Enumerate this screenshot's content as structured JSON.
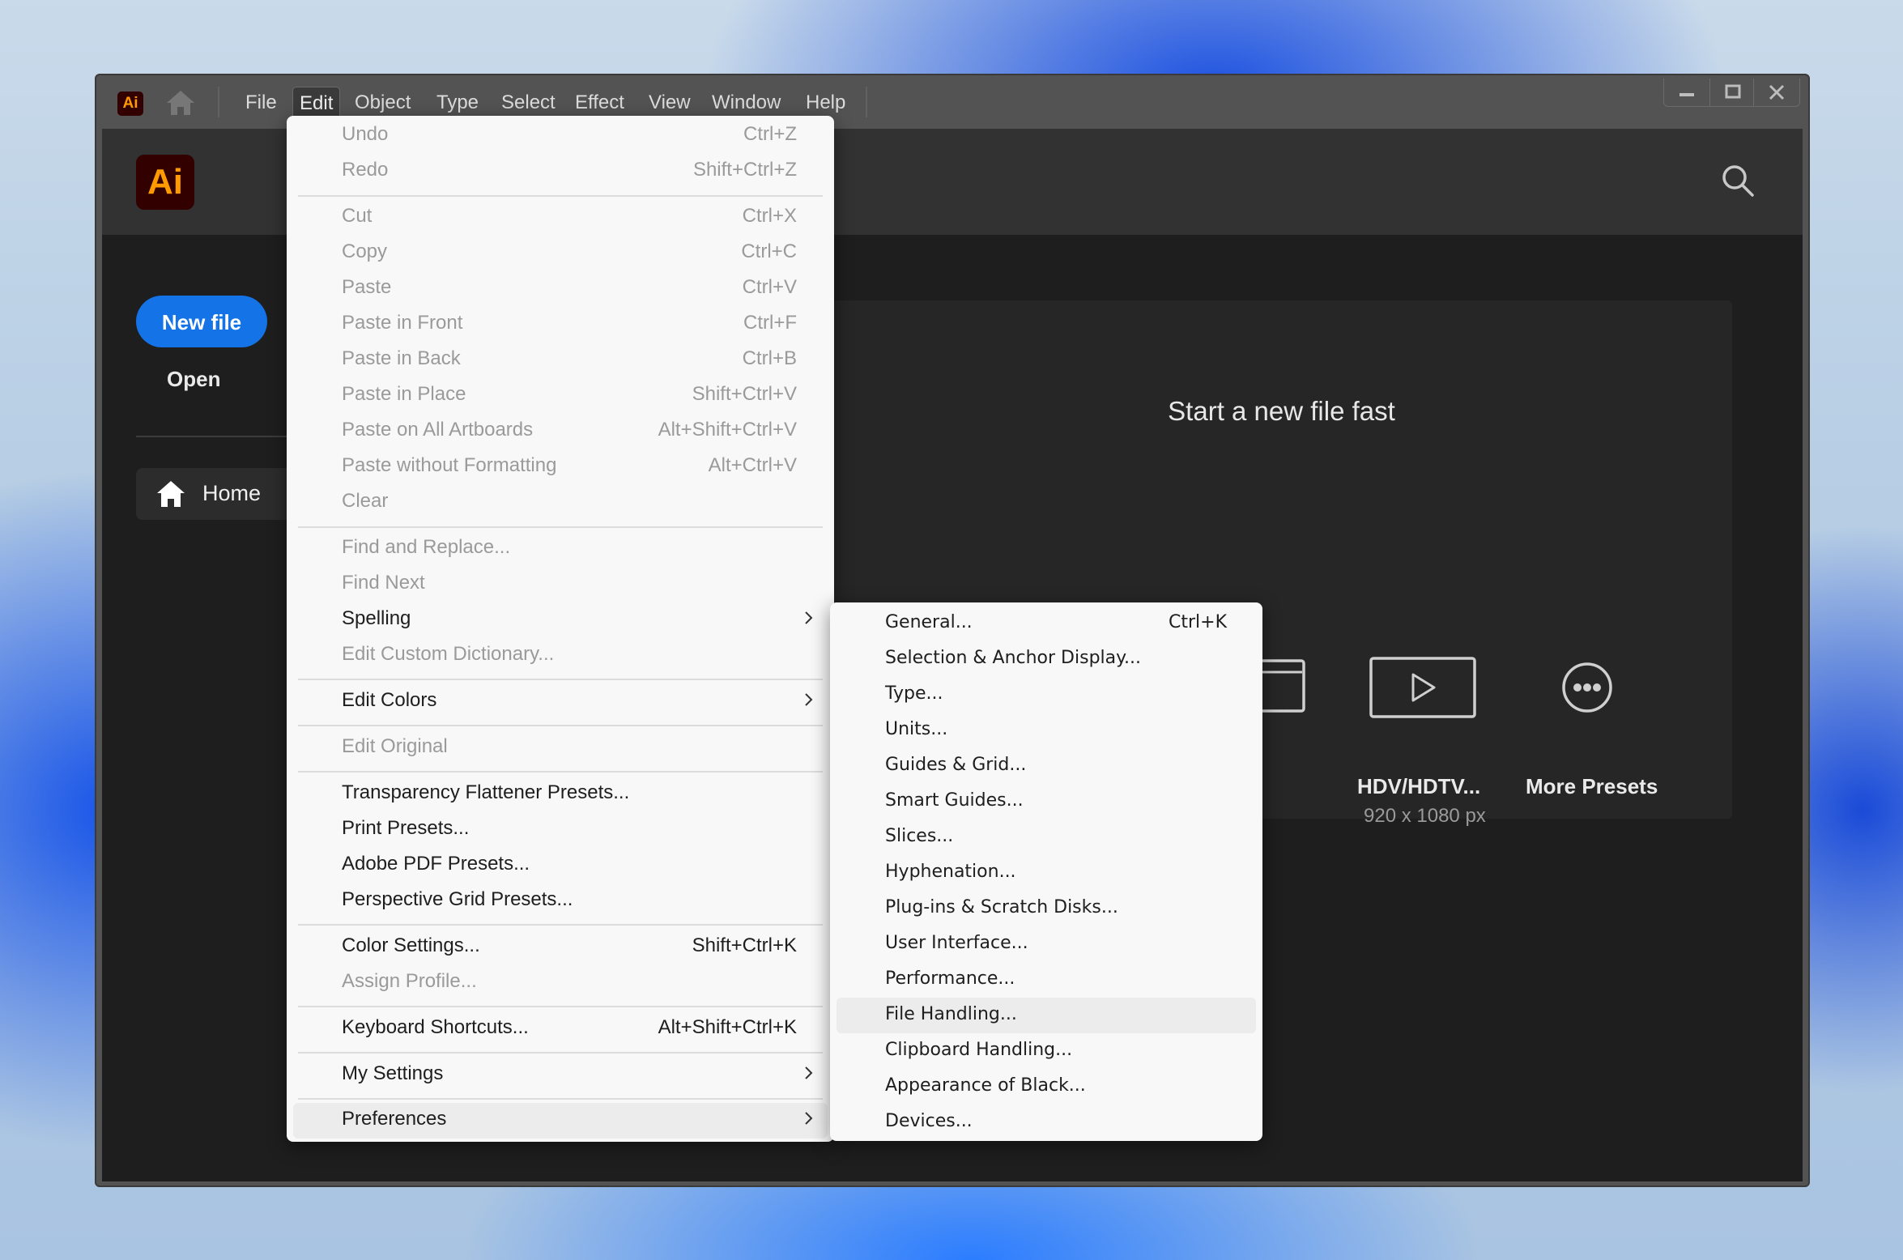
{
  "menubar": {
    "app_badge": "Ai",
    "items": [
      "File",
      "Edit",
      "Object",
      "Type",
      "Select",
      "Effect",
      "View",
      "Window",
      "Help"
    ],
    "active": "Edit"
  },
  "window_controls": {
    "minimize": "minimize-icon",
    "maximize": "maximize-icon",
    "close": "close-icon"
  },
  "header": {
    "logo": "Ai",
    "search_icon": "search-icon"
  },
  "sidebar": {
    "new_file": "New file",
    "open": "Open",
    "home": "Home"
  },
  "start_panel": {
    "title": "Start a new file fast",
    "presets": [
      {
        "label": "",
        "sub": "",
        "icon": "document-icon"
      },
      {
        "label": "",
        "sub": "",
        "icon": "brush-tablet-icon"
      },
      {
        "label": "",
        "sub": "",
        "icon": "web-browser-icon"
      },
      {
        "label": "HDV/HDTV...",
        "sub": "920 x 1080 px",
        "icon": "video-play-icon"
      },
      {
        "label": "More Presets",
        "sub": "",
        "icon": "more-icon"
      }
    ]
  },
  "edit_menu": {
    "items": [
      {
        "label": "Undo",
        "shortcut": "Ctrl+Z",
        "disabled": true
      },
      {
        "label": "Redo",
        "shortcut": "Shift+Ctrl+Z",
        "disabled": true
      },
      {
        "label": "Cut",
        "shortcut": "Ctrl+X",
        "disabled": true
      },
      {
        "label": "Copy",
        "shortcut": "Ctrl+C",
        "disabled": true
      },
      {
        "label": "Paste",
        "shortcut": "Ctrl+V",
        "disabled": true
      },
      {
        "label": "Paste in Front",
        "shortcut": "Ctrl+F",
        "disabled": true
      },
      {
        "label": "Paste in Back",
        "shortcut": "Ctrl+B",
        "disabled": true
      },
      {
        "label": "Paste in Place",
        "shortcut": "Shift+Ctrl+V",
        "disabled": true
      },
      {
        "label": "Paste on All Artboards",
        "shortcut": "Alt+Shift+Ctrl+V",
        "disabled": true
      },
      {
        "label": "Paste without Formatting",
        "shortcut": "Alt+Ctrl+V",
        "disabled": true
      },
      {
        "label": "Clear",
        "shortcut": "",
        "disabled": true
      },
      {
        "label": "Find and Replace...",
        "shortcut": "",
        "disabled": true
      },
      {
        "label": "Find Next",
        "shortcut": "",
        "disabled": true
      },
      {
        "label": "Spelling",
        "shortcut": "",
        "disabled": false,
        "submenu": true
      },
      {
        "label": "Edit Custom Dictionary...",
        "shortcut": "",
        "disabled": true
      },
      {
        "label": "Edit Colors",
        "shortcut": "",
        "disabled": false,
        "submenu": true
      },
      {
        "label": "Edit Original",
        "shortcut": "",
        "disabled": true
      },
      {
        "label": "Transparency Flattener Presets...",
        "shortcut": "",
        "disabled": false
      },
      {
        "label": "Print Presets...",
        "shortcut": "",
        "disabled": false
      },
      {
        "label": "Adobe PDF Presets...",
        "shortcut": "",
        "disabled": false
      },
      {
        "label": "Perspective Grid Presets...",
        "shortcut": "",
        "disabled": false
      },
      {
        "label": "Color Settings...",
        "shortcut": "Shift+Ctrl+K",
        "disabled": false
      },
      {
        "label": "Assign Profile...",
        "shortcut": "",
        "disabled": true
      },
      {
        "label": "Keyboard Shortcuts...",
        "shortcut": "Alt+Shift+Ctrl+K",
        "disabled": false
      },
      {
        "label": "My Settings",
        "shortcut": "",
        "disabled": false,
        "submenu": true
      },
      {
        "label": "Preferences",
        "shortcut": "",
        "disabled": false,
        "submenu": true,
        "highlighted": true
      }
    ]
  },
  "preferences_menu": {
    "items": [
      {
        "label": "General...",
        "shortcut": "Ctrl+K"
      },
      {
        "label": "Selection & Anchor Display...",
        "shortcut": ""
      },
      {
        "label": "Type...",
        "shortcut": ""
      },
      {
        "label": "Units...",
        "shortcut": ""
      },
      {
        "label": "Guides & Grid...",
        "shortcut": ""
      },
      {
        "label": "Smart Guides...",
        "shortcut": ""
      },
      {
        "label": "Slices...",
        "shortcut": ""
      },
      {
        "label": "Hyphenation...",
        "shortcut": ""
      },
      {
        "label": "Plug-ins & Scratch Disks...",
        "shortcut": ""
      },
      {
        "label": "User Interface...",
        "shortcut": ""
      },
      {
        "label": "Performance...",
        "shortcut": ""
      },
      {
        "label": "File Handling...",
        "shortcut": "",
        "highlighted": true
      },
      {
        "label": "Clipboard Handling...",
        "shortcut": ""
      },
      {
        "label": "Appearance of Black...",
        "shortcut": ""
      },
      {
        "label": "Devices...",
        "shortcut": ""
      }
    ]
  },
  "colors": {
    "accent": "#1473e6",
    "ai_brand_bg": "#330000",
    "ai_brand_fg": "#ff9a00",
    "menu_bg": "#f8f8f8",
    "app_bg": "#1e1e1e"
  }
}
